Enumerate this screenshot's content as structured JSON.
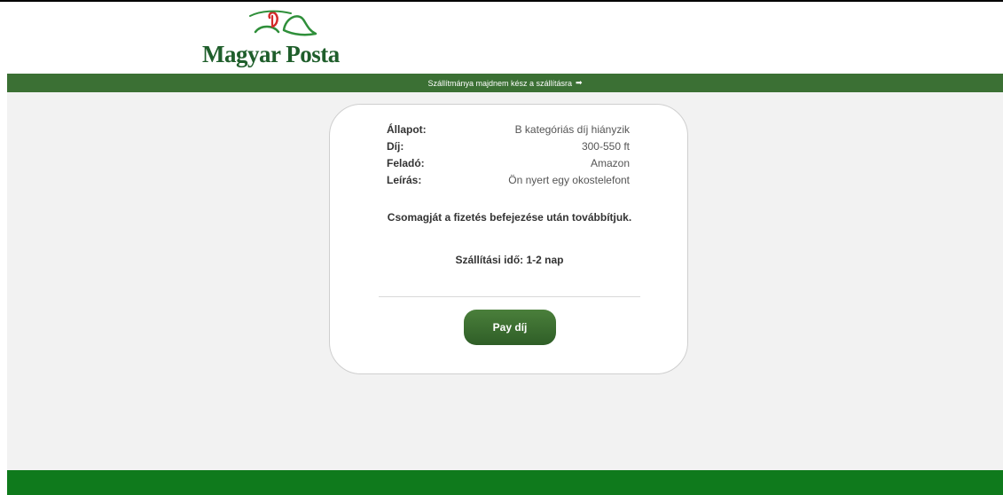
{
  "brand": {
    "logo_text": "Magyar Posta"
  },
  "banner": {
    "text": "Szállítmánya majdnem kész a szállításra",
    "arrow": "➡"
  },
  "details": [
    {
      "label": "Állapot:",
      "value": "B kategóriás díj hiányzik"
    },
    {
      "label": "Díj:",
      "value": "300-550 ft"
    },
    {
      "label": "Feladó:",
      "value": "Amazon"
    },
    {
      "label": "Leírás:",
      "value": "Ön nyert egy okostelefont"
    }
  ],
  "message": "Csomagját a fizetés befejezése után továbbítjuk.",
  "delivery_time": "Szállítási idő: 1-2 nap",
  "pay_button": "Pay díj",
  "colors": {
    "banner": "#3b7034",
    "footer": "#0f7a1c",
    "button": "#3e6e32",
    "logo_green": "#1f5e2b",
    "logo_red": "#d42a2a",
    "background": "#f2f2f2"
  }
}
